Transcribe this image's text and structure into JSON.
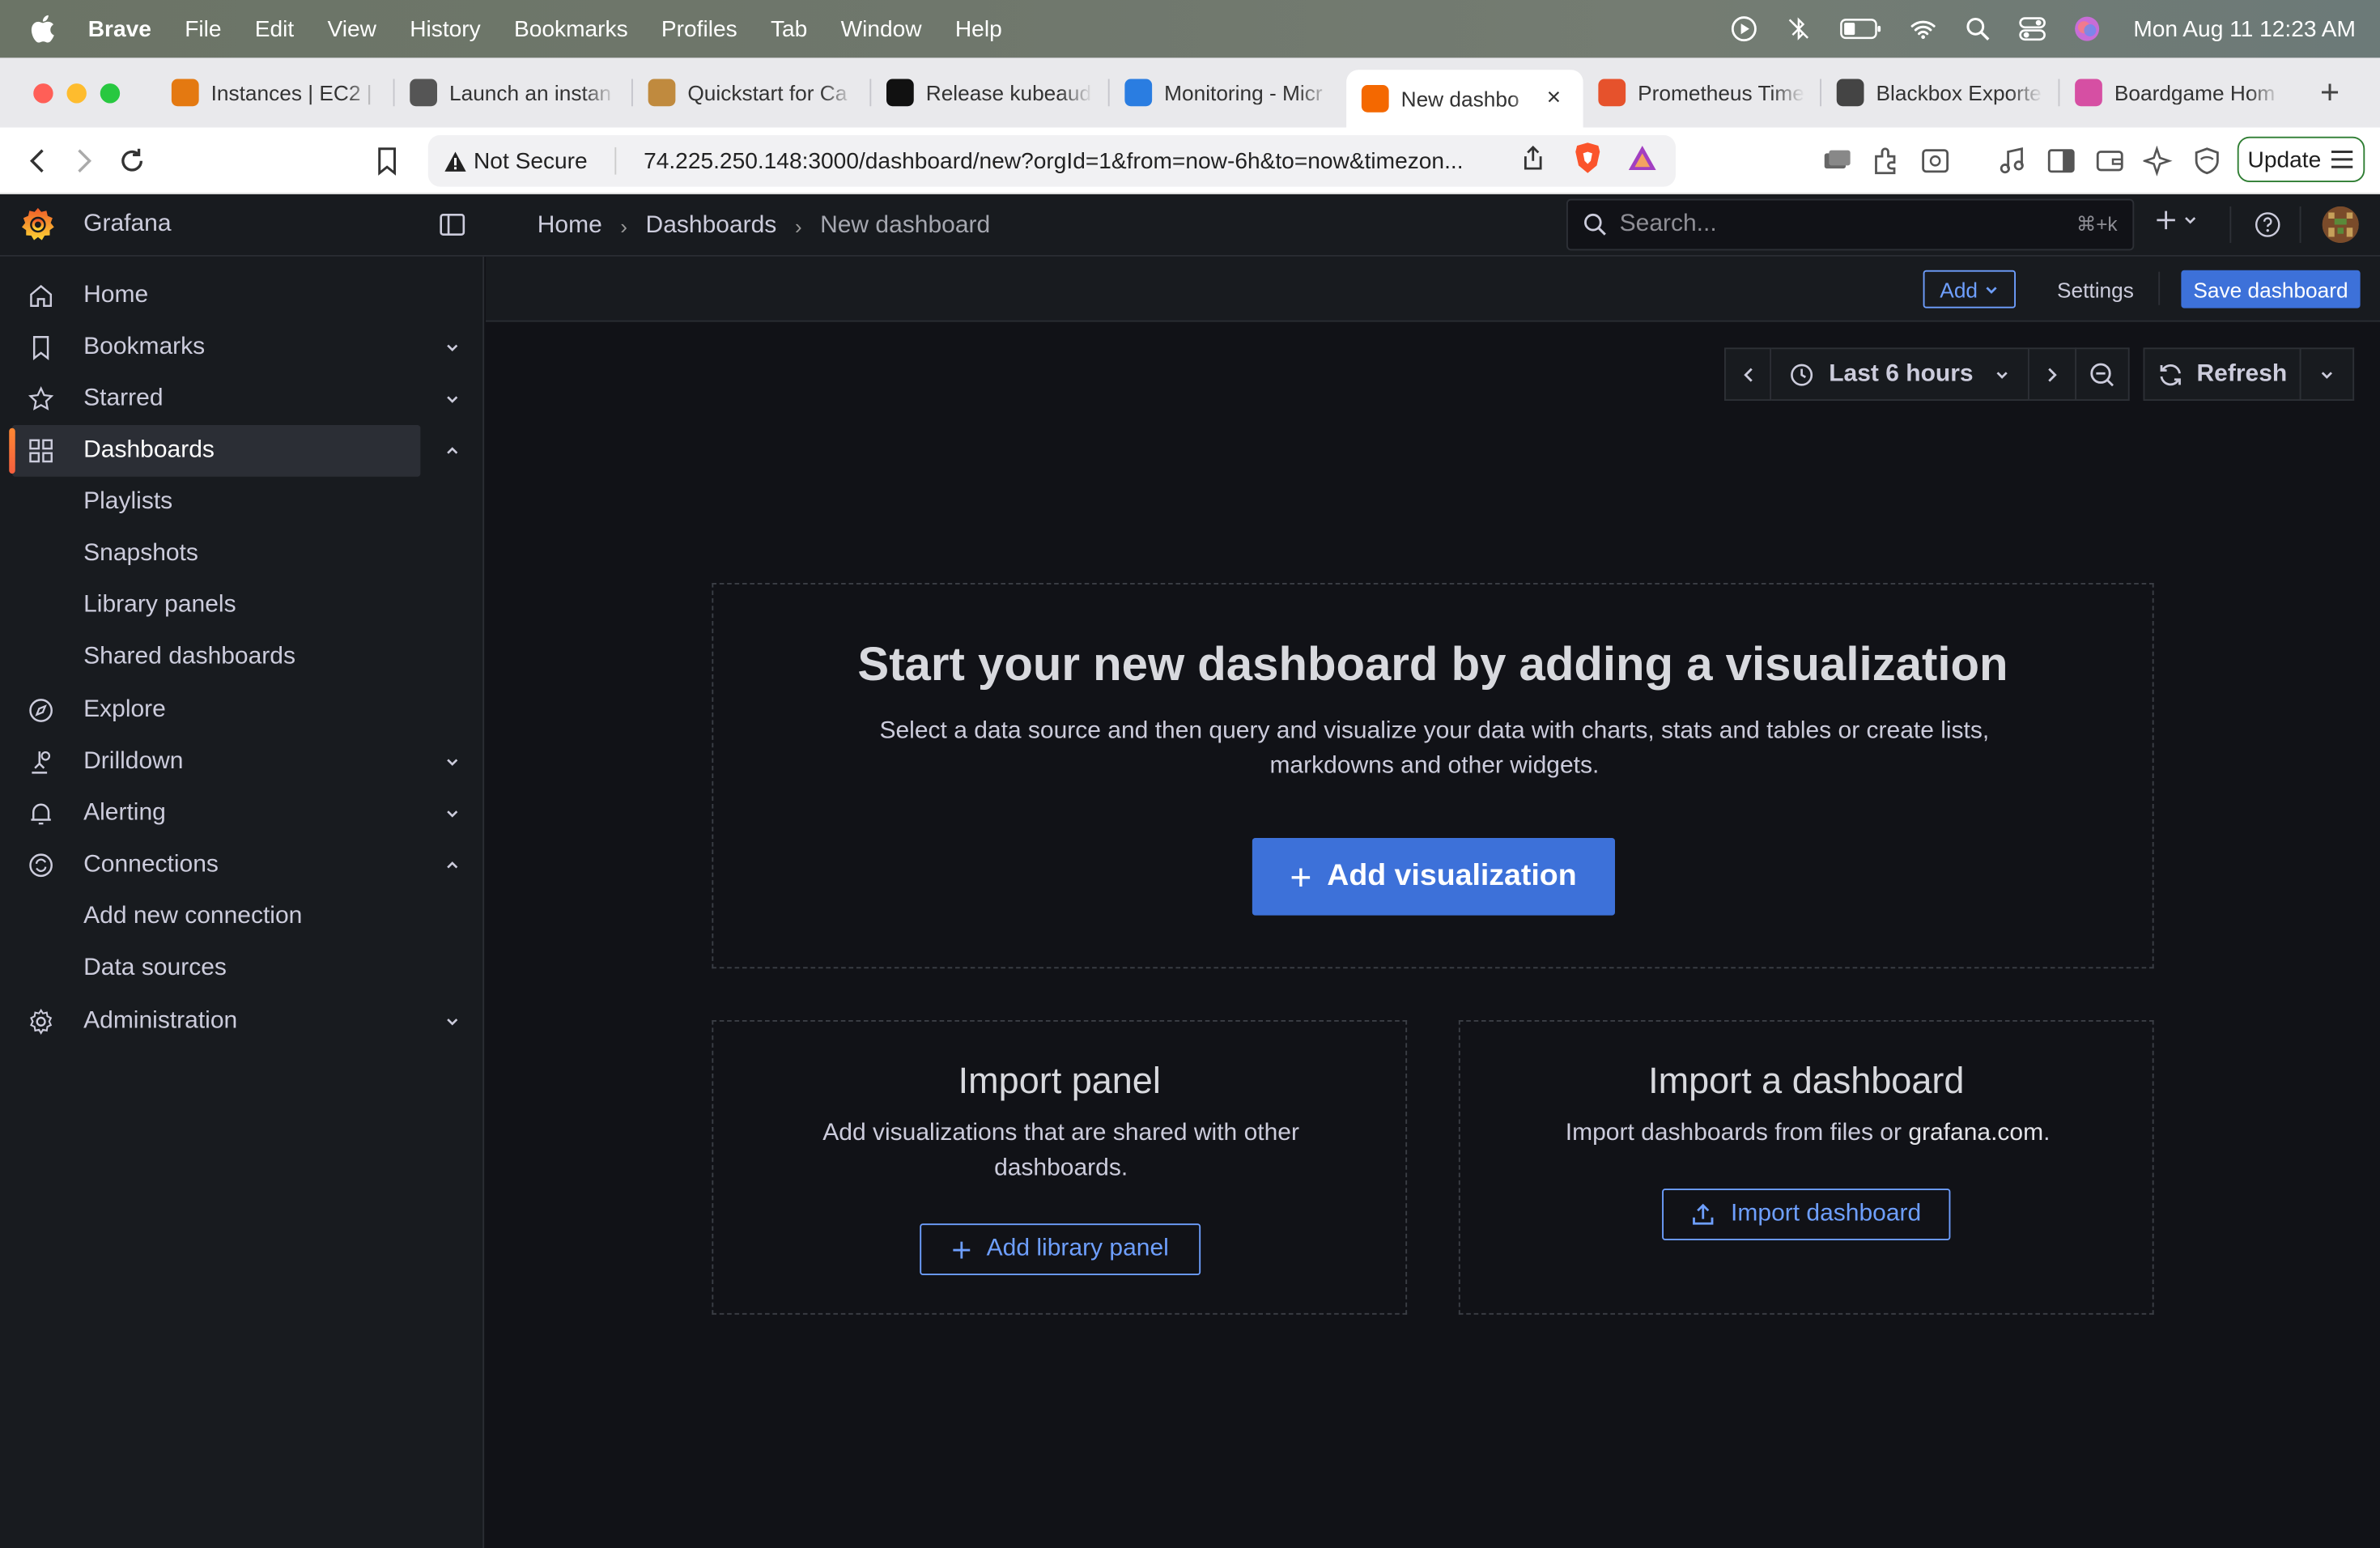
{
  "menubar": {
    "app_name": "Brave",
    "items": [
      "File",
      "Edit",
      "View",
      "History",
      "Bookmarks",
      "Profiles",
      "Tab",
      "Window",
      "Help"
    ],
    "clock": "Mon Aug 11  12:23 AM"
  },
  "tabs": [
    {
      "title": "Instances | EC2 |",
      "favicon_color": "#e47911",
      "active": false
    },
    {
      "title": "Launch an instan",
      "favicon_color": "#555555",
      "active": false
    },
    {
      "title": "Quickstart for Ca",
      "favicon_color": "#c08a3e",
      "active": false
    },
    {
      "title": "Release kubeaud",
      "favicon_color": "#111111",
      "active": false
    },
    {
      "title": "Monitoring - Micr",
      "favicon_color": "#2a7de1",
      "active": false
    },
    {
      "title": "New dashbo",
      "favicon_color": "#f46800",
      "active": true
    },
    {
      "title": "Prometheus Time",
      "favicon_color": "#e6522c",
      "active": false
    },
    {
      "title": "Blackbox Exporte",
      "favicon_color": "#444444",
      "active": false
    },
    {
      "title": "Boardgame Hom",
      "favicon_color": "#d64fa3",
      "active": false
    }
  ],
  "address": {
    "security_label": "Not Secure",
    "url": "74.225.250.148:3000/dashboard/new?orgId=1&from=now-6h&to=now&timezon..."
  },
  "browser": {
    "update_label": "Update"
  },
  "grafana": {
    "brand": "Grafana",
    "breadcrumb": [
      "Home",
      "Dashboards",
      "New dashboard"
    ],
    "search_placeholder": "Search...",
    "search_shortcut": "⌘+k"
  },
  "sidebar": {
    "items": [
      {
        "label": "Home",
        "icon": "home-icon"
      },
      {
        "label": "Bookmarks",
        "icon": "bookmark-icon"
      },
      {
        "label": "Starred",
        "icon": "star-icon"
      },
      {
        "label": "Dashboards",
        "icon": "apps-icon"
      },
      {
        "label": "Explore",
        "icon": "compass-icon"
      },
      {
        "label": "Drilldown",
        "icon": "drilldown-icon"
      },
      {
        "label": "Alerting",
        "icon": "bell-icon"
      },
      {
        "label": "Connections",
        "icon": "link-icon"
      },
      {
        "label": "Administration",
        "icon": "cog-icon"
      }
    ],
    "dashboards_children": [
      "Playlists",
      "Snapshots",
      "Library panels",
      "Shared dashboards"
    ],
    "connections_children": [
      "Add new connection",
      "Data sources"
    ]
  },
  "toolbar": {
    "add_label": "Add",
    "settings_label": "Settings",
    "save_label": "Save dashboard"
  },
  "time": {
    "range_label": "Last 6 hours",
    "refresh_label": "Refresh"
  },
  "empty_state": {
    "title": "Start your new dashboard by adding a visualization",
    "description": "Select a data source and then query and visualize your data with charts, stats and tables or create lists, markdowns and other widgets.",
    "add_visualization_label": "Add visualization"
  },
  "import_panel": {
    "title": "Import panel",
    "description": "Add visualizations that are shared with other dashboards.",
    "button_label": "Add library panel"
  },
  "import_dashboard": {
    "title": "Import a dashboard",
    "description_prefix": "Import dashboards from files or ",
    "link_text": "grafana.com",
    "description_suffix": ".",
    "button_label": "Import dashboard"
  },
  "colors": {
    "accent": "#3d71d9",
    "link_blue": "#6e9fff",
    "active_bar": "#f55f3e",
    "background": "#111217",
    "panel": "#181b1f"
  }
}
